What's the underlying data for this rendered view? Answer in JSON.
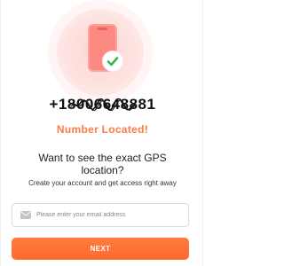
{
  "phone_number": "+18006648881",
  "status_text": "Number Located!",
  "headline": "Want to see the exact GPS location?",
  "subheadline": "Create your account and get access right away",
  "email_field": {
    "placeholder": "Please enter your email address",
    "value": "",
    "icon": "envelope-icon"
  },
  "next_button": {
    "label": "NEXT"
  },
  "icons": {
    "illustration": "phone-icon",
    "badge": "checkmark-icon"
  },
  "colors": {
    "accent": "#ff6f35",
    "status_text": "#ff7a45",
    "phone": "#fc8a82",
    "check": "#35b84a"
  }
}
